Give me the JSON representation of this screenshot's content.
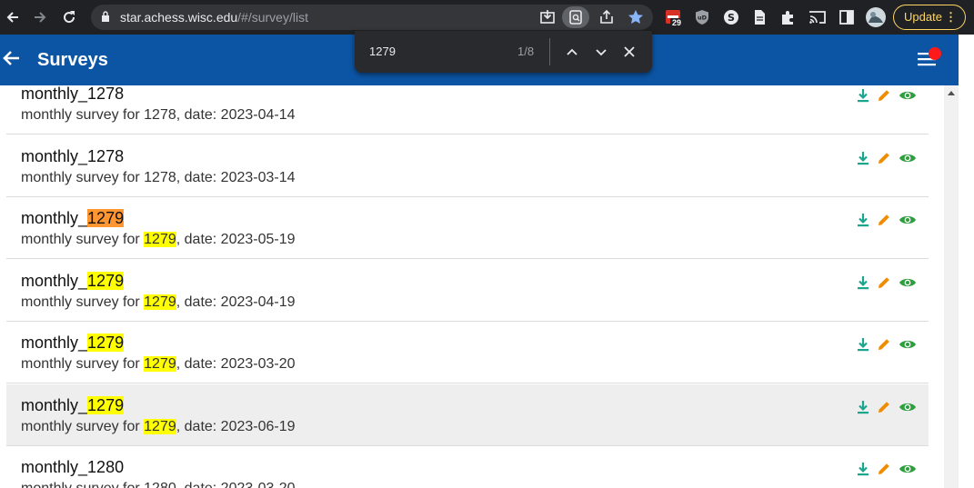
{
  "browser": {
    "url_host": "star.achess.wisc.edu",
    "url_path": "/#/survey/list",
    "calendar_badge": "29",
    "update_label": "Update",
    "update_menu": "⋮"
  },
  "find_bar": {
    "query": "1279",
    "count": "1/8"
  },
  "appbar": {
    "title": "Surveys"
  },
  "surveys": [
    {
      "name_prefix": "monthly_",
      "name_match": "",
      "name_rest": "1278",
      "desc_prefix": "monthly survey for ",
      "desc_match": "",
      "desc_rest": "1278, date: 2023-04-14"
    },
    {
      "name_prefix": "monthly_",
      "name_match": "",
      "name_rest": "1278",
      "desc_prefix": "monthly survey for ",
      "desc_match": "",
      "desc_rest": "1278, date: 2023-03-14"
    },
    {
      "name_prefix": "monthly_",
      "name_match": "1279",
      "name_rest": "",
      "desc_prefix": "monthly survey for ",
      "desc_match": "1279",
      "desc_rest": ", date: 2023-05-19"
    },
    {
      "name_prefix": "monthly_",
      "name_match": "1279",
      "name_rest": "",
      "desc_prefix": "monthly survey for ",
      "desc_match": "1279",
      "desc_rest": ", date: 2023-04-19"
    },
    {
      "name_prefix": "monthly_",
      "name_match": "1279",
      "name_rest": "",
      "desc_prefix": "monthly survey for ",
      "desc_match": "1279",
      "desc_rest": ", date: 2023-03-20"
    },
    {
      "name_prefix": "monthly_",
      "name_match": "1279",
      "name_rest": "",
      "desc_prefix": "monthly survey for ",
      "desc_match": "1279",
      "desc_rest": ", date: 2023-06-19"
    },
    {
      "name_prefix": "monthly_",
      "name_match": "",
      "name_rest": "1280",
      "desc_prefix": "monthly survey for ",
      "desc_match": "",
      "desc_rest": "1280, date: 2023-03-20"
    }
  ],
  "colors": {
    "appbar": "#0c55a5",
    "download": "#1aa58c",
    "edit": "#ef8c00",
    "view": "#2e9e3e",
    "match": "#ffff00",
    "active_match": "#ff9632"
  }
}
